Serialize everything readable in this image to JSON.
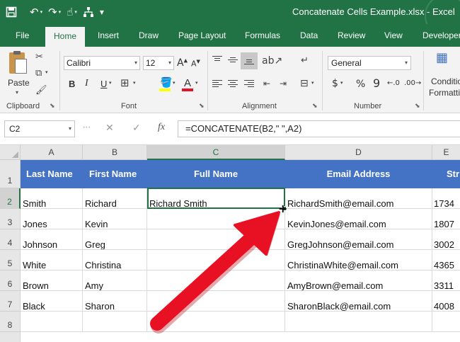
{
  "window": {
    "title": "Concatenate Cells Example.xlsx - Excel"
  },
  "quick_access": [
    {
      "name": "save-icon",
      "glyph": "🖫"
    },
    {
      "name": "undo-icon",
      "glyph": "↶"
    },
    {
      "name": "redo-icon",
      "glyph": "↷"
    },
    {
      "name": "touch-mode-icon",
      "glyph": "☝"
    },
    {
      "name": "connector-icon",
      "glyph": "⚛"
    },
    {
      "name": "customize-qat-icon",
      "glyph": "▾"
    }
  ],
  "ribbon_tabs": [
    "File",
    "Home",
    "Insert",
    "Draw",
    "Page Layout",
    "Formulas",
    "Data",
    "Review",
    "View",
    "Developer"
  ],
  "active_tab": "Home",
  "ribbon": {
    "clipboard": {
      "label": "Clipboard",
      "paste_label": "Paste"
    },
    "font": {
      "label": "Font",
      "font_name": "Calibri",
      "font_size": "12",
      "bold": "B",
      "italic": "I",
      "underline": "U",
      "grow": "A",
      "shrink": "A",
      "font_color": "A",
      "fill_color_hex": "#ffff00",
      "font_color_hex": "#e81123"
    },
    "alignment": {
      "label": "Alignment"
    },
    "number": {
      "label": "Number",
      "format": "General",
      "currency": "$",
      "percent": "%",
      "comma": "9"
    },
    "styles": {
      "cond_line1": "Conditio",
      "cond_line2": "Formatti"
    }
  },
  "formula_bar": {
    "name_box": "C2",
    "cancel": "✕",
    "enter": "✓",
    "fx": "fx",
    "formula": "=CONCATENATE(B2,\" \",A2)"
  },
  "sheet": {
    "columns": [
      "A",
      "B",
      "C",
      "D",
      "E"
    ],
    "selected_column": "C",
    "row_numbers": [
      "1",
      "2",
      "3",
      "4",
      "5",
      "6",
      "7",
      "8"
    ],
    "selected_row": "2",
    "header_row": [
      "Last Name",
      "First Name",
      "Full Name",
      "Email Address",
      "Str"
    ],
    "header_color": "#4472c4",
    "rows": [
      [
        "Smith",
        "Richard",
        "Richard Smith",
        "RichardSmith@email.com",
        "1734"
      ],
      [
        "Jones",
        "Kevin",
        "",
        "KevinJones@email.com",
        "1807"
      ],
      [
        "Johnson",
        "Greg",
        "",
        "GregJohnson@email.com",
        "3002"
      ],
      [
        "White",
        "Christina",
        "",
        "ChristinaWhite@email.com",
        "4365"
      ],
      [
        "Brown",
        "Amy",
        "",
        "AmyBrown@email.com",
        "3311"
      ],
      [
        "Black",
        "Sharon",
        "",
        "SharonBlack@email.com",
        "4008"
      ],
      [
        "",
        "",
        "",
        "",
        ""
      ]
    ],
    "active_cell": "C2"
  },
  "annotation": {
    "arrow_color": "#e81123"
  },
  "colors": {
    "excel_green": "#217346",
    "ribbon_bg": "#f3f3f3"
  }
}
